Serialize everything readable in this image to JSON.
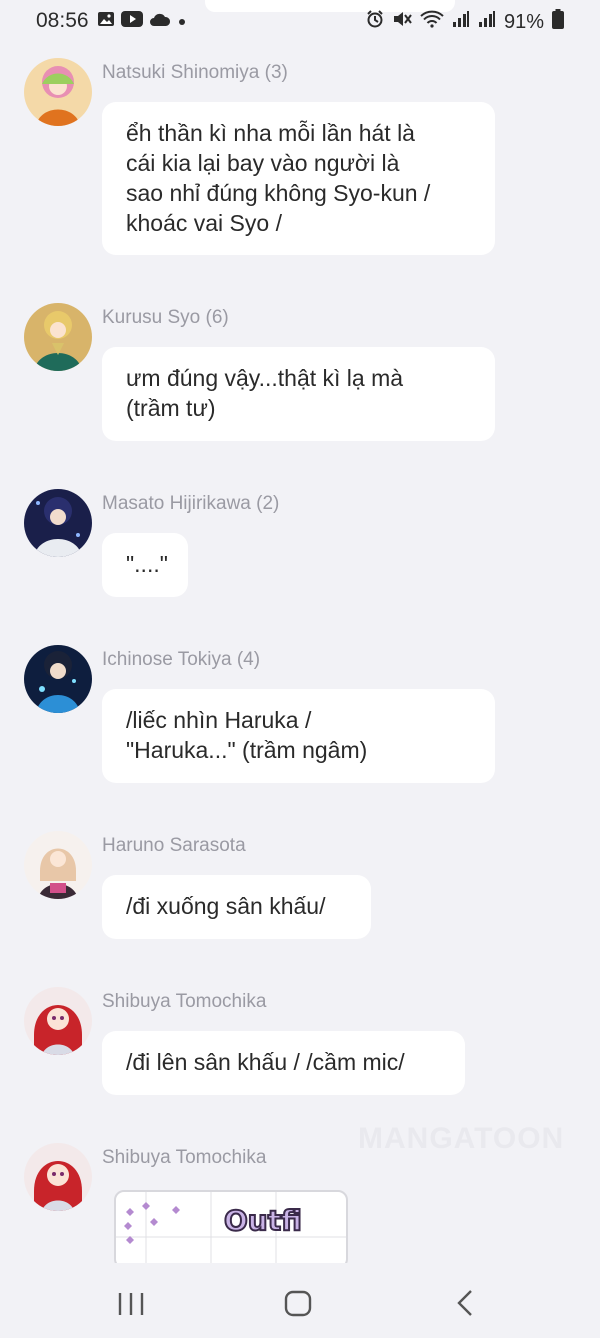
{
  "status_bar": {
    "time": "08:56",
    "battery": "91%",
    "icons": [
      "gallery-icon",
      "youtube-icon",
      "cloud-icon",
      "dot-icon",
      "alarm-icon",
      "mute-icon",
      "wifi-icon",
      "signal-icon",
      "signal-icon",
      "battery-icon"
    ]
  },
  "messages": [
    {
      "sender": "Natsuki Shinomiya (3)",
      "lines": [
        "ểh thần kì nha mỗi lần hát là",
        "cái kia lại bay vào người là",
        "sao nhỉ đúng không Syo-kun /",
        "khoác vai Syo /"
      ]
    },
    {
      "sender": "Kurusu Syo (6)",
      "lines": [
        "ưm đúng vậy...thật kì lạ mà",
        "(trầm tư)"
      ]
    },
    {
      "sender": "Masato Hijirikawa (2)",
      "lines": [
        "\"....\""
      ]
    },
    {
      "sender": "Ichinose Tokiya (4)",
      "lines": [
        "/liếc nhìn Haruka /",
        "\"Haruka...\" (trầm ngâm)"
      ]
    },
    {
      "sender": "Haruno Sarasota",
      "lines": [
        "/đi xuống sân khấu/"
      ]
    },
    {
      "sender": "Shibuya Tomochika",
      "lines": [
        "/đi lên sân khấu / /cầm mic/"
      ]
    },
    {
      "sender": "Shibuya Tomochika",
      "sticker_text": "Outfi"
    }
  ],
  "watermark": "MANGATOON",
  "colors": {
    "background": "#f2f2f6",
    "bubble": "#ffffff",
    "sender": "#9a9aa3",
    "text": "#2a2a2a"
  },
  "nav_bar": {
    "buttons": [
      "recent-apps-icon",
      "home-icon",
      "back-icon"
    ]
  }
}
